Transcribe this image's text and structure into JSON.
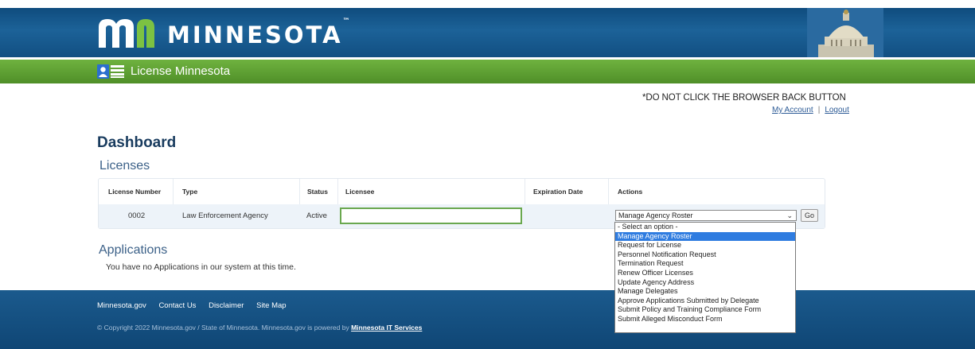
{
  "brand": {
    "logo_text": "MINNESOTA",
    "app_name": "License Minnesota"
  },
  "notice": "*DO NOT CLICK THE BROWSER BACK BUTTON",
  "account": {
    "my_account": "My Account",
    "separator": "|",
    "logout": "Logout"
  },
  "dashboard": {
    "title": "Dashboard",
    "licenses_heading": "Licenses",
    "columns": [
      "License Number",
      "Type",
      "Status",
      "Licensee",
      "Expiration Date",
      "Actions"
    ],
    "rows": [
      {
        "license_number": "0002",
        "type": "Law Enforcement Agency",
        "status": "Active",
        "licensee": "",
        "expiration_date": "",
        "action_selected": "Manage Agency Roster",
        "go_label": "Go"
      }
    ],
    "action_options": [
      "- Select an option -",
      "Manage Agency Roster",
      "Request for License",
      "Personnel Notification Request",
      "Termination Request",
      "Renew Officer Licenses",
      "Update Agency Address",
      "Manage Delegates",
      "Approve Applications Submitted by Delegate",
      "Submit Policy and Training Compliance Form",
      "Submit Alleged Misconduct Form"
    ],
    "highlighted_option_index": 1,
    "applications_heading": "Applications",
    "applications_empty": "You have no Applications in our system at this time."
  },
  "footer": {
    "links": [
      "Minnesota.gov",
      "Contact Us",
      "Disclaimer",
      "Site Map"
    ],
    "copyright": "© Copyright 2022 Minnesota.gov / State of Minnesota. Minnesota.gov is powered by",
    "copyright_link": "Minnesota IT Services"
  },
  "colors": {
    "header_blue": "#1c6298",
    "green_bar": "#5c9e31",
    "highlight_blue": "#2f7ce0",
    "input_border_green": "#6aa84f"
  }
}
